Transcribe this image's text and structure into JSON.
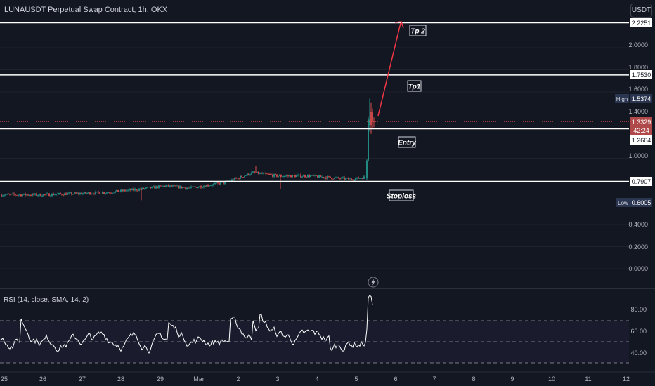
{
  "header": {
    "symbol_title": "LUNAUSDT Perpetual Swap Contract, 1h, OKX",
    "currency": "USDT"
  },
  "price_axis": {
    "ticks": [
      "2.0000",
      "1.8000",
      "1.6000",
      "1.4000",
      "1.0000",
      "0.4000",
      "0.2000",
      "0.0000"
    ],
    "tick_values": [
      2.0,
      1.8,
      1.6,
      1.4,
      1.0,
      0.4,
      0.2,
      0.0
    ],
    "badges": {
      "tp2_level": "2.2251",
      "tp1_level": "1.7530",
      "high_label": "High",
      "high_value": "1.5374",
      "last_price": "1.3329",
      "countdown": "42:24",
      "entry_level": "1.2664",
      "stoploss_level": "0.7907",
      "low_label": "Low",
      "low_value": "0.6005"
    }
  },
  "levels": {
    "tp2": 2.2251,
    "tp1": 1.753,
    "entry": 1.2664,
    "stoploss": 0.7907,
    "last": 1.3329
  },
  "annotations": {
    "tp2": "Tp 2",
    "tp1": "Tp1",
    "entry": "Entry",
    "stoploss": "Stoploss"
  },
  "rsi": {
    "label": "RSI (14, close, SMA, 14, 2)",
    "ticks": [
      "80.00",
      "60.00",
      "40.00"
    ],
    "tick_values": [
      80,
      60,
      40
    ],
    "band_upper": 70,
    "band_middle": 50,
    "band_lower": 30
  },
  "time_axis": {
    "labels": [
      "25",
      "26",
      "27",
      "28",
      "29",
      "Mar",
      "2",
      "3",
      "4",
      "5",
      "6",
      "7",
      "8",
      "9",
      "10",
      "11",
      "12"
    ]
  },
  "colors": {
    "background": "#131722",
    "up": "#26a69a",
    "down": "#ef5350",
    "level_line": "#ffffff",
    "arrow": "#f23645",
    "rsi_line": "#ffffff",
    "rsi_fill": "#7e57c2",
    "last_price_badge": "#b04a4a",
    "info_badge": "#2a3550"
  },
  "icons": {
    "lightning": "lightning-icon"
  }
}
